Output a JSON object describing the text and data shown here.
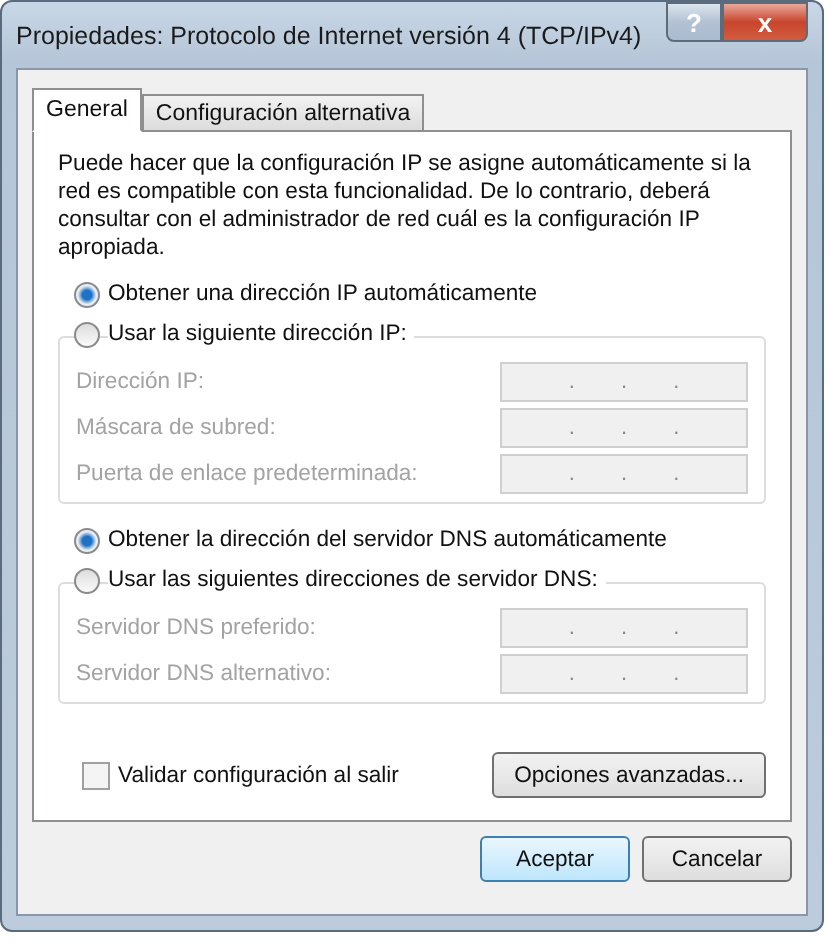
{
  "window": {
    "title": "Propiedades: Protocolo de Internet versión 4 (TCP/IPv4)",
    "controls": [
      "?",
      "x"
    ]
  },
  "tabs": [
    {
      "label": "General",
      "selected": true
    },
    {
      "label": "Configuración alternativa",
      "selected": false
    }
  ],
  "description": "Puede hacer que la configuración IP se asigne automáticamente si la red es compatible con esta funcionalidad. De lo contrario, deberá consultar con el administrador de red cuál es la configuración IP apropiada.",
  "ip_options": [
    {
      "label": "Obtener una dirección IP automáticamente",
      "selected": true
    },
    {
      "label": "Usar la siguiente dirección IP:",
      "selected": false
    }
  ],
  "ip_fields": [
    {
      "label": "Dirección IP:",
      "disabled": true,
      "dots": ". . ."
    },
    {
      "label": "Máscara de subred:",
      "disabled": true,
      "dots": ". . ."
    },
    {
      "label": "Puerta de enlace predeterminada:",
      "disabled": true,
      "dots": ". . ."
    }
  ],
  "dns_options": [
    {
      "label": "Obtener la dirección del servidor DNS automáticamente",
      "selected": true
    },
    {
      "label": "Usar las siguientes direcciones de servidor DNS:",
      "selected": false
    }
  ],
  "dns_fields": [
    {
      "label": "Servidor DNS preferido:",
      "disabled": true,
      "dots": ". . ."
    },
    {
      "label": "Servidor DNS alternativo:",
      "disabled": true,
      "dots": ". . ."
    }
  ],
  "validate": {
    "label": "Validar configuración al salir",
    "checked": false
  },
  "advanced_button": "Opciones avanzadas...",
  "buttons": [
    {
      "label": "Aceptar",
      "kind": "default"
    },
    {
      "label": "Cancelar",
      "kind": "normal"
    }
  ]
}
